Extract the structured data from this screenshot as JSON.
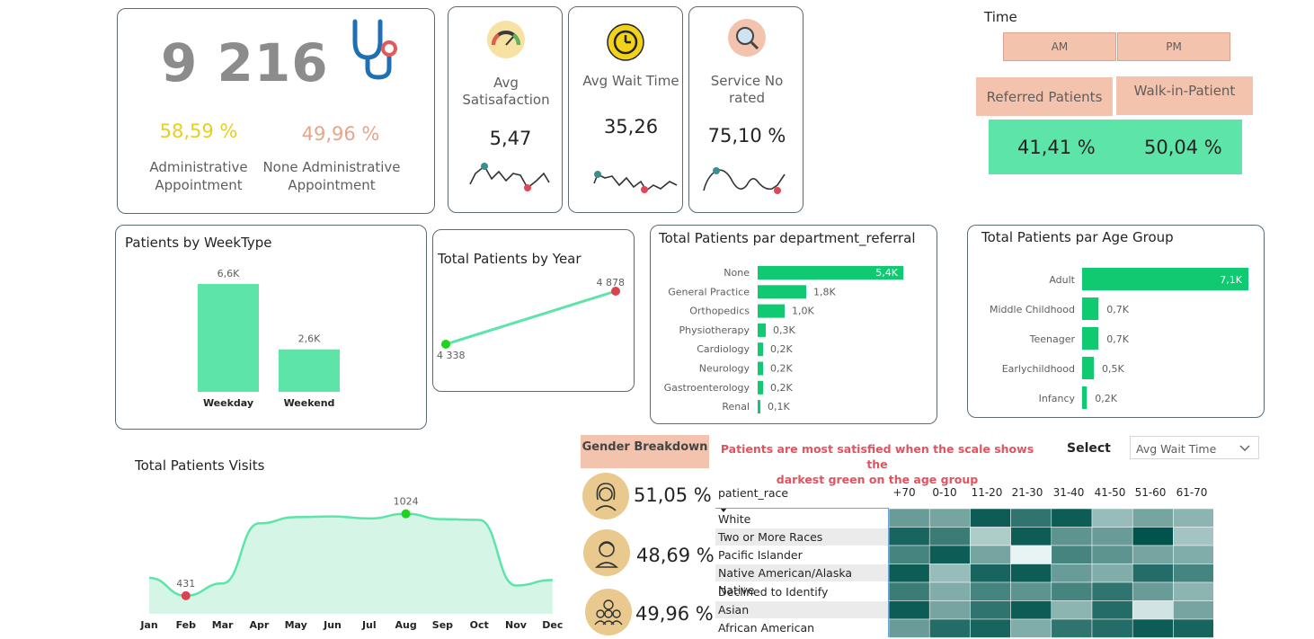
{
  "summary": {
    "total": "9 216",
    "admin_pct": "58,59 %",
    "admin_label_1": "Administrative",
    "admin_label_2": "Appointment",
    "nonadmin_pct": "49,96 %",
    "nonadmin_label_1": "None Administrative",
    "nonadmin_label_2": "Appointment",
    "icon": "stethoscope-icon"
  },
  "kpis": [
    {
      "title_1": "Avg",
      "title_2": "Satisafaction",
      "value": "5,47",
      "icon": "gauge-icon"
    },
    {
      "title_1": "Avg Wait Time",
      "title_2": "",
      "value": "35,26",
      "icon": "clock-icon"
    },
    {
      "title_1": "Service No",
      "title_2": "rated",
      "value": "75,10 %",
      "icon": "search-icon"
    }
  ],
  "time_filter": {
    "title": "Time",
    "am": "AM",
    "pm": "PM",
    "referred_label": "Referred Patients",
    "walkin_label": "Walk-in-Patient",
    "referred_value": "41,41 %",
    "walkin_value": "50,04 %"
  },
  "weektype": {
    "title": "Patients by WeekType",
    "chart_data": {
      "type": "bar",
      "categories": [
        "Weekday",
        "Weekend"
      ],
      "values": [
        6.6,
        2.6
      ],
      "data_labels": [
        "6,6K",
        "2,6K"
      ],
      "unit": "K"
    }
  },
  "year": {
    "title": "Total Patients by Year",
    "chart_data": {
      "type": "line",
      "values": [
        4338,
        4878
      ],
      "data_labels": [
        "4 338",
        "4 878"
      ]
    }
  },
  "dept": {
    "title": "Total Patients par department_referral",
    "chart_data": {
      "type": "bar",
      "orientation": "horizontal",
      "categories": [
        "None",
        "General Practice",
        "Orthopedics",
        "Physiotherapy",
        "Cardiology",
        "Neurology",
        "Gastroenterology",
        "Renal"
      ],
      "values": [
        5.4,
        1.8,
        1.0,
        0.3,
        0.2,
        0.2,
        0.2,
        0.1
      ],
      "data_labels": [
        "5,4K",
        "1,8K",
        "1,0K",
        "0,3K",
        "0,2K",
        "0,2K",
        "0,2K",
        "0,1K"
      ]
    }
  },
  "age": {
    "title": "Total Patients par Age Group",
    "chart_data": {
      "type": "bar",
      "orientation": "horizontal",
      "categories": [
        "Adult",
        "Middle Childhood",
        "Teenager",
        "Earlychildhood",
        "Infancy"
      ],
      "values": [
        7.1,
        0.7,
        0.7,
        0.5,
        0.2
      ],
      "data_labels": [
        "7,1K",
        "0,7K",
        "0,7K",
        "0,5K",
        "0,2K"
      ]
    }
  },
  "visits": {
    "title": "Total Patients Visits",
    "chart_data": {
      "type": "area",
      "categories": [
        "Jan",
        "Feb",
        "Mar",
        "Apr",
        "May",
        "Jun",
        "Jul",
        "Aug",
        "Sep",
        "Oct",
        "Nov",
        "Dec"
      ],
      "values": [
        560,
        431,
        520,
        955,
        1000,
        1005,
        990,
        1024,
        985,
        980,
        505,
        545
      ],
      "min_label": "431",
      "max_label": "1024"
    }
  },
  "gender": {
    "title": "Gender Breakdown",
    "items": [
      {
        "value": "51,05 %",
        "icon": "female-icon"
      },
      {
        "value": "48,69 %",
        "icon": "male-icon"
      },
      {
        "value": "49,96 %",
        "icon": "group-icon"
      }
    ]
  },
  "note": {
    "line1": "Patients are most satisfied when the scale shows the",
    "line2": "darkest green on the age group"
  },
  "selector": {
    "label": "Select",
    "value": "Avg Wait Time"
  },
  "heatmap": {
    "row_header": "patient_race",
    "columns": [
      "+70",
      "0-10",
      "11-20",
      "21-30",
      "31-40",
      "41-50",
      "51-60",
      "61-70"
    ],
    "rows": [
      "White",
      "Two or More Races",
      "Pacific Islander",
      "Native American/Alaska Native",
      "Declined to Identify",
      "Asian",
      "African American"
    ],
    "chart_data": {
      "type": "heatmap",
      "intensity": [
        [
          0.55,
          0.5,
          0.95,
          0.8,
          0.95,
          0.35,
          0.5,
          0.4
        ],
        [
          0.9,
          0.75,
          0.25,
          0.95,
          0.6,
          0.55,
          1.0,
          0.3
        ],
        [
          0.7,
          0.95,
          0.5,
          0.0,
          0.7,
          0.6,
          0.5,
          0.45
        ],
        [
          0.95,
          0.35,
          0.9,
          0.95,
          0.55,
          0.45,
          0.85,
          0.7
        ],
        [
          0.75,
          0.45,
          0.7,
          0.6,
          0.7,
          0.8,
          0.55,
          0.4
        ],
        [
          0.95,
          0.5,
          0.8,
          0.95,
          0.4,
          0.85,
          0.1,
          0.5
        ],
        [
          0.55,
          0.85,
          0.9,
          0.45,
          0.8,
          0.85,
          0.95,
          0.9
        ]
      ]
    }
  }
}
